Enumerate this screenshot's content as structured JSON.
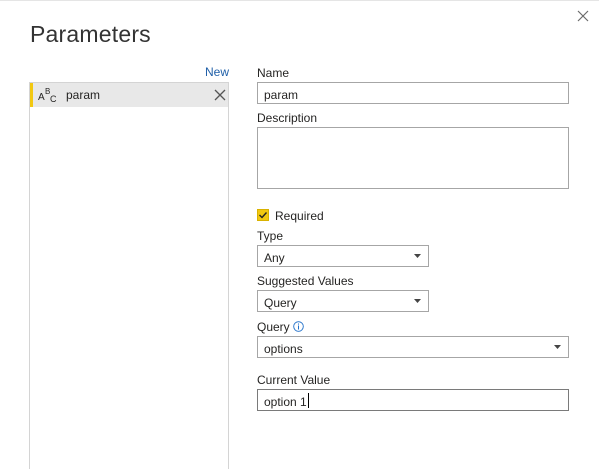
{
  "dialog": {
    "title": "Parameters",
    "close_label": "close"
  },
  "list": {
    "new_label": "New",
    "items": [
      {
        "name": "param",
        "type_icon": "text-type-icon",
        "selected": true
      }
    ]
  },
  "form": {
    "name_label": "Name",
    "name_value": "param",
    "description_label": "Description",
    "description_value": "",
    "required_label": "Required",
    "required_checked": true,
    "type_label": "Type",
    "type_value": "Any",
    "suggested_label": "Suggested Values",
    "suggested_value": "Query",
    "query_label": "Query",
    "query_value": "options",
    "current_value_label": "Current Value",
    "current_value": "option 1"
  },
  "colors": {
    "accent": "#f2c811",
    "link": "#1f5fa8",
    "selection_bg": "#e8e8e8",
    "info_icon": "#1f6fc9"
  }
}
